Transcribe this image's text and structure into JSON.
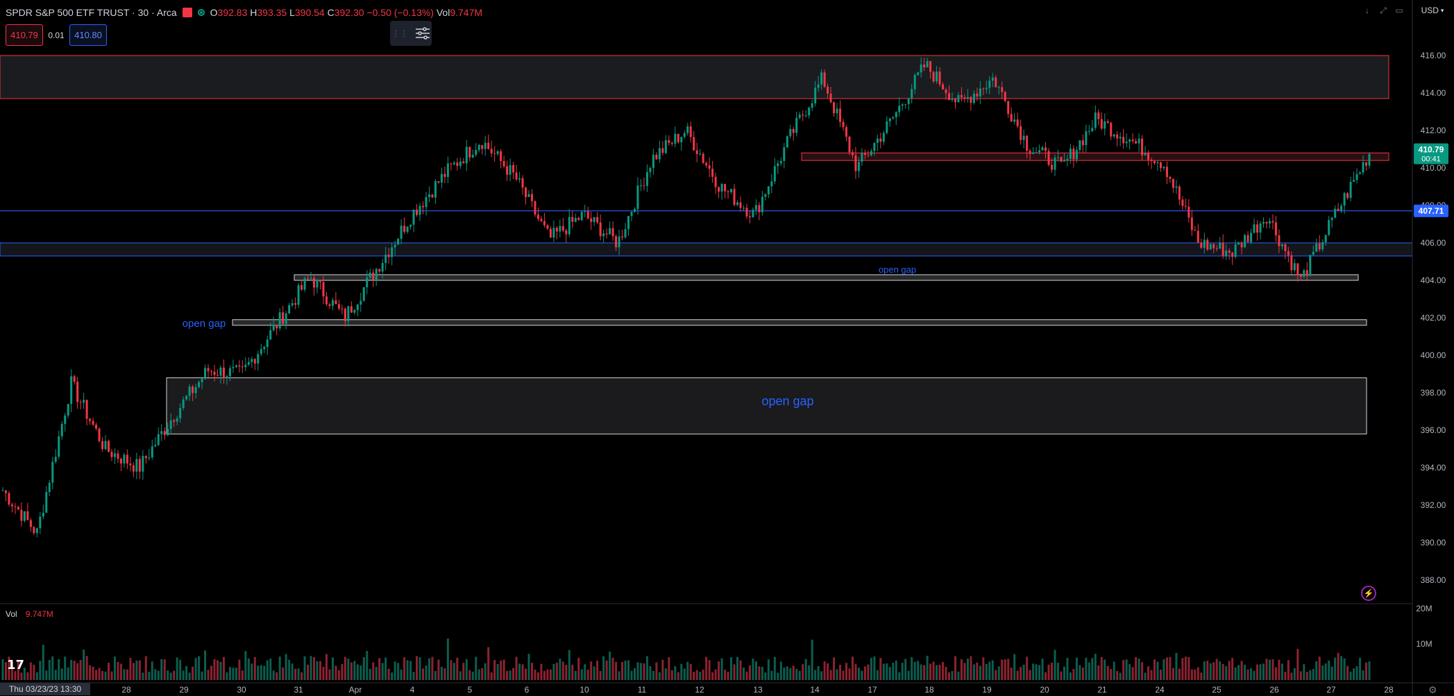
{
  "header": {
    "symbol": "SPDR S&P 500 ETF TRUST · 30 · Arca",
    "open_label": "O",
    "open": "392.83",
    "high_label": "H",
    "high": "393.35",
    "low_label": "L",
    "low": "390.54",
    "close_label": "C",
    "close": "392.30",
    "change": "−0.50 (−0.13%)",
    "vol_label": "Vol",
    "vol": "9.747M"
  },
  "trade": {
    "bid": "410.79",
    "spread": "0.01",
    "ask": "410.80"
  },
  "currency": "USD",
  "volume_pane": {
    "label": "Vol",
    "value": "9.747M",
    "ticks": [
      "20M",
      "10M"
    ]
  },
  "date_badge": "Thu 03/23/23   13:30",
  "price_badges": {
    "last": "410.79",
    "countdown": "00:41",
    "line": "407.71"
  },
  "axis": {
    "price_ticks": [
      "416.00",
      "414.00",
      "412.00",
      "410.00",
      "408.00",
      "406.00",
      "404.00",
      "402.00",
      "400.00",
      "398.00",
      "396.00",
      "394.00",
      "392.00",
      "390.00",
      "388.00"
    ],
    "time_ticks": [
      "28",
      "29",
      "30",
      "31",
      "Apr",
      "4",
      "5",
      "6",
      "10",
      "11",
      "12",
      "13",
      "14",
      "17",
      "18",
      "19",
      "20",
      "21",
      "24",
      "25",
      "26",
      "27",
      "28"
    ]
  },
  "annotations": {
    "gap_small": "open gap",
    "gap_left": "open gap",
    "gap_large": "open gap"
  },
  "colors": {
    "up": "#089981",
    "down": "#f23645",
    "blue_line": "#2962ff",
    "zone_red": "#f23645"
  },
  "chart_data": {
    "type": "candlestick",
    "symbol": "SPY",
    "interval": "30",
    "price_range": [
      387,
      416.5
    ],
    "key_points": [
      [
        "03-23",
        392.8
      ],
      [
        "03-23",
        390.5
      ],
      [
        "03-24",
        398.5
      ],
      [
        "03-24",
        395.0
      ],
      [
        "03-27",
        394.0
      ],
      [
        "03-27",
        396.8
      ],
      [
        "03-28",
        399.2
      ],
      [
        "03-29",
        399.0
      ],
      [
        "03-29",
        401.6
      ],
      [
        "03-30",
        404.2
      ],
      [
        "03-30",
        402.0
      ],
      [
        "03-31",
        404.8
      ],
      [
        "03-31",
        407.6
      ],
      [
        "04-03",
        409.8
      ],
      [
        "04-04",
        411.5
      ],
      [
        "04-04",
        409.5
      ],
      [
        "04-05",
        406.2
      ],
      [
        "04-06",
        407.5
      ],
      [
        "04-10",
        406.0
      ],
      [
        "04-11",
        410.5
      ],
      [
        "04-12",
        412.0
      ],
      [
        "04-12",
        409.0
      ],
      [
        "04-13",
        407.5
      ],
      [
        "04-13",
        411.5
      ],
      [
        "04-14",
        414.8
      ],
      [
        "04-14",
        410.0
      ],
      [
        "04-17",
        412.5
      ],
      [
        "04-18",
        415.5
      ],
      [
        "04-18",
        413.4
      ],
      [
        "04-19",
        414.8
      ],
      [
        "04-20",
        411.2
      ],
      [
        "04-21",
        410.0
      ],
      [
        "04-24",
        412.6
      ],
      [
        "04-25",
        411.5
      ],
      [
        "04-25",
        410.2
      ],
      [
        "04-26",
        406.0
      ],
      [
        "04-26",
        405.5
      ],
      [
        "04-26",
        407.5
      ],
      [
        "04-26",
        404.0
      ],
      [
        "04-27",
        407.5
      ],
      [
        "04-27",
        410.79
      ]
    ],
    "zones": [
      {
        "kind": "resistance",
        "low": 413.7,
        "high": 416.0
      },
      {
        "kind": "resistance",
        "low": 410.4,
        "high": 410.8
      },
      {
        "kind": "support-band",
        "low": 405.3,
        "high": 406.0
      },
      {
        "kind": "gap",
        "label": "open gap",
        "low": 404.0,
        "high": 404.3
      },
      {
        "kind": "gap",
        "label": "open gap",
        "low": 401.6,
        "high": 401.9
      },
      {
        "kind": "gap",
        "label": "open gap",
        "low": 395.8,
        "high": 398.8
      }
    ],
    "horizontal_line": 407.71
  }
}
